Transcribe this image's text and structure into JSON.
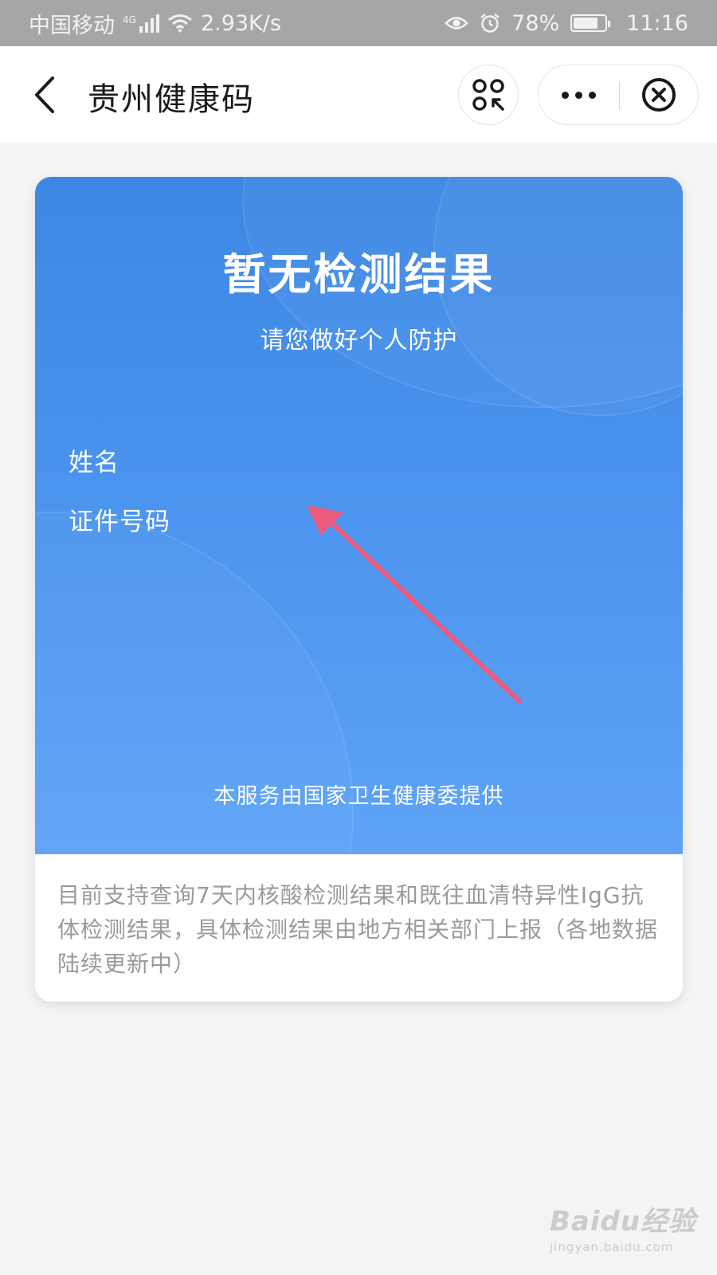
{
  "status_bar": {
    "carrier": "中国移动",
    "network_type": "4G",
    "speed": "2.93K/s",
    "battery": "78%",
    "battery_level": 0.78,
    "time": "11:16"
  },
  "nav": {
    "title": "贵州健康码"
  },
  "card": {
    "title": "暂无检测结果",
    "subtitle": "请您做好个人防护",
    "name_label": "姓名",
    "id_label": "证件号码",
    "provider": "本服务由国家卫生健康委提供",
    "notice": "目前支持查询7天内核酸检测结果和既往血清特异性IgG抗体检测结果，具体检测结果由地方相关部门上报（各地数据陆续更新中）"
  },
  "watermark": {
    "brand": "Baidu经验",
    "url": "jingyan.baidu.com"
  },
  "colors": {
    "card_blue": "#4a93ee",
    "arrow_pink": "#ee5a7c",
    "notice_gray": "#9a9a9a"
  },
  "icons": [
    "signal-icon",
    "wifi-icon",
    "eye-icon",
    "alarm-icon",
    "battery-icon",
    "back-icon",
    "scan-icon",
    "more-icon",
    "close-icon"
  ]
}
